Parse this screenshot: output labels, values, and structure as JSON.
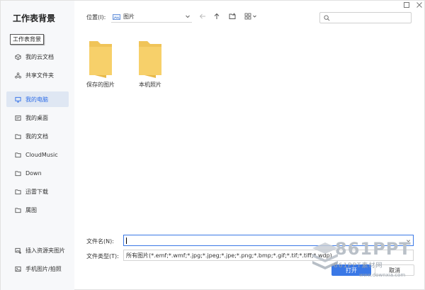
{
  "window": {
    "maximize_icon": "maximize-icon",
    "close_icon": "close-icon"
  },
  "sidebar": {
    "title": "工作表背景",
    "tooltip": "工作表背景",
    "items": [
      {
        "label": "我的云文档",
        "icon": "cloud-doc-icon",
        "active": false
      },
      {
        "label": "共享文件夹",
        "icon": "share-folder-icon",
        "active": false
      },
      {
        "label": "我的电脑",
        "icon": "computer-icon",
        "active": true
      },
      {
        "label": "我的桌面",
        "icon": "desktop-icon",
        "active": false
      },
      {
        "label": "我的文档",
        "icon": "documents-icon",
        "active": false
      },
      {
        "label": "CloudMusic",
        "icon": "folder-icon",
        "active": false
      },
      {
        "label": "Down",
        "icon": "folder-icon",
        "active": false
      },
      {
        "label": "迅雷下载",
        "icon": "folder-icon",
        "active": false
      },
      {
        "label": "属图",
        "icon": "folder-icon",
        "active": false
      }
    ],
    "bottom_items": [
      {
        "label": "插入资源夹图片",
        "icon": "insert-image-icon"
      },
      {
        "label": "手机图片/拍照",
        "icon": "phone-image-icon"
      }
    ]
  },
  "toolbar": {
    "location_label": "位置(I):",
    "location_value": "图片",
    "search_placeholder": ""
  },
  "files": [
    {
      "name": "保存的图片",
      "type": "folder"
    },
    {
      "name": "本机照片",
      "type": "folder"
    }
  ],
  "form": {
    "filename_label": "文件名(N):",
    "filename_value": "",
    "filetype_label": "文件类型(T):",
    "filetype_value": "所有图片(*.emf;*.wmf;*.jpg;*.jpeg;*.jpe;*.png;*.bmp;*.gif;*.tif;*.tiff;*.wdp)"
  },
  "buttons": {
    "open": "打开",
    "cancel": "取消"
  },
  "watermark": {
    "brand": "861PPT",
    "subtitle": "861PPT素材网",
    "url": "www.downxia.com"
  },
  "colors": {
    "accent": "#3a78e6",
    "active_bg": "#dfe7f3",
    "folder": "#f5c85c"
  }
}
